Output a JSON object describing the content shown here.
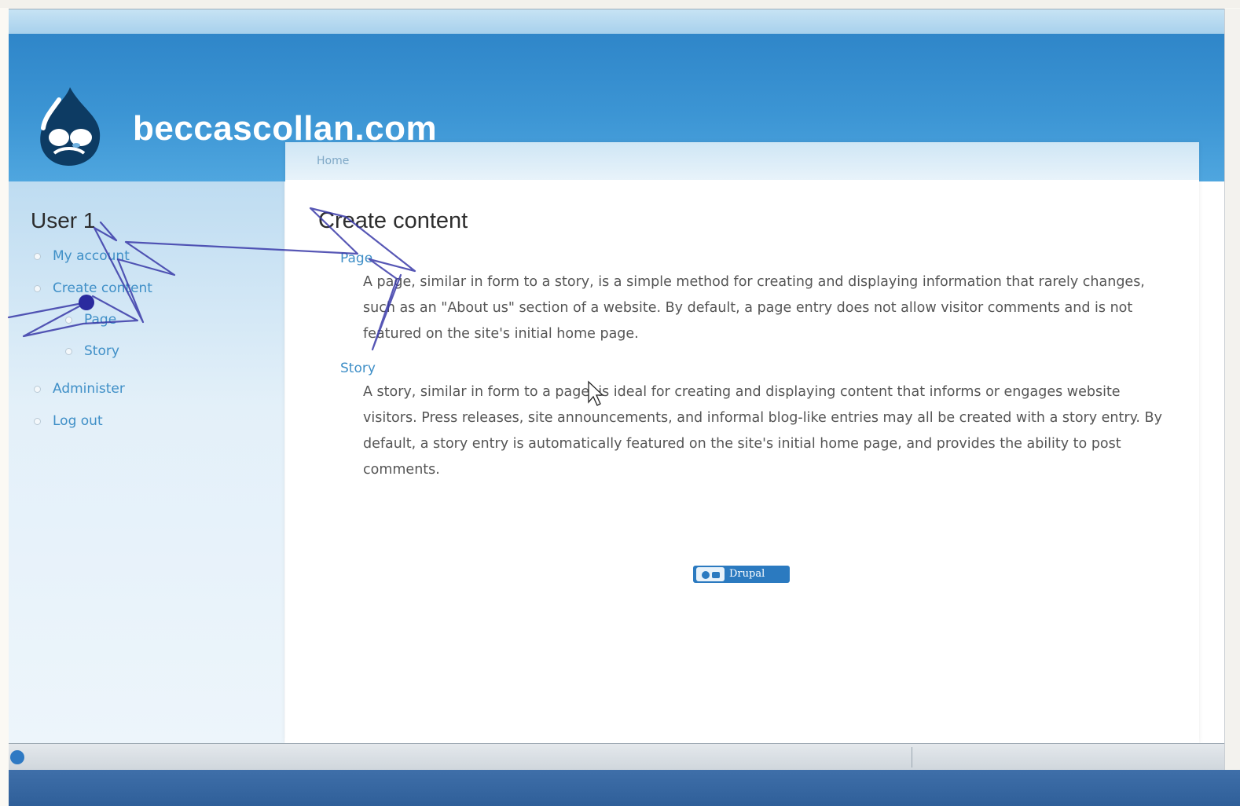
{
  "site": {
    "name": "beccascollan.com",
    "brand_color": "#2f86c9"
  },
  "breadcrumb": {
    "home": "Home"
  },
  "sidebar": {
    "title": "User 1",
    "items": [
      {
        "label": "My account"
      },
      {
        "label": "Create content"
      },
      {
        "label": "Page"
      },
      {
        "label": "Story"
      },
      {
        "label": "Administer"
      },
      {
        "label": "Log out"
      }
    ]
  },
  "main": {
    "title": "Create content",
    "types": [
      {
        "label": "Page",
        "description": "A page, similar in form to a story, is a simple method for creating and displaying information that rarely changes, such as an \"About us\" section of a website. By default, a page entry does not allow visitor comments and is not featured on the site's initial home page."
      },
      {
        "label": "Story",
        "description": "A story, similar in form to a page, is ideal for creating and displaying content that informs or engages website visitors. Press releases, site announcements, and informal blog-like entries may all be created with a story entry. By default, a story entry is automatically featured on the site's initial home page, and provides the ability to post comments."
      }
    ]
  },
  "footer": {
    "powered_by": "Drupal"
  },
  "icons": {
    "logo": "drupal-drop-icon",
    "badge": "drupal-badge-icon",
    "status": "ie-status-icon"
  },
  "colors": {
    "link": "#3f8fc7",
    "annotation": "#3a3aa8"
  }
}
